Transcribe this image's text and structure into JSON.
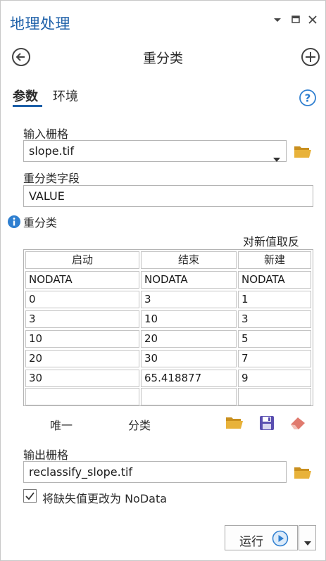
{
  "pane": {
    "title": "地理处理"
  },
  "tool": {
    "title": "重分类"
  },
  "tabs": [
    {
      "label": "参数",
      "active": true
    },
    {
      "label": "环境",
      "active": false
    }
  ],
  "params": {
    "input_raster_label": "输入栅格",
    "input_raster_value": "slope.tif",
    "reclass_field_label": "重分类字段",
    "reclass_field_value": "VALUE",
    "reclass_label": "重分类",
    "reverse_values_label": "对新值取反"
  },
  "reclass_table": {
    "columns": [
      "启动",
      "结束",
      "新建"
    ],
    "rows": [
      [
        "NODATA",
        "NODATA",
        "NODATA"
      ],
      [
        "0",
        "3",
        "1"
      ],
      [
        "3",
        "10",
        "3"
      ],
      [
        "10",
        "20",
        "5"
      ],
      [
        "20",
        "30",
        "7"
      ],
      [
        "30",
        "65.418877",
        "9"
      ],
      [
        "",
        "",
        ""
      ]
    ],
    "unique_label": "唯一",
    "classify_label": "分类"
  },
  "output": {
    "output_raster_label": "输出栅格",
    "output_raster_value": "reclassify_slope.tif",
    "nodata_checkbox_label": "将缺失值更改为 NoData",
    "nodata_checked": true
  },
  "footer": {
    "run_label": "运行"
  },
  "colors": {
    "accent": "#1c5fa8",
    "folder": "#e0a82e",
    "save": "#5a4fb0",
    "eraser": "#e07a6e",
    "info": "#2f7fd0"
  },
  "icons": {
    "back": "back-arrow-icon",
    "add": "add-circle-icon",
    "help": "help-icon",
    "info": "info-icon",
    "folder": "folder-icon",
    "save": "save-icon",
    "eraser": "eraser-icon",
    "run": "play-icon"
  }
}
